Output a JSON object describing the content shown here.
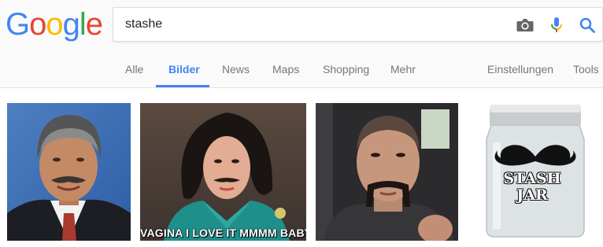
{
  "logo": {
    "letters": [
      "G",
      "o",
      "o",
      "g",
      "l",
      "e"
    ],
    "colors": [
      "#4285f4",
      "#ea4335",
      "#fbbc05",
      "#4285f4",
      "#34a853",
      "#ea4335"
    ]
  },
  "search": {
    "query": "stashe"
  },
  "icons": {
    "camera": "camera-icon",
    "microphone": "microphone-icon",
    "search": "search-icon"
  },
  "tabs": {
    "items": [
      {
        "label": "Alle"
      },
      {
        "label": "Bilder",
        "active": true
      },
      {
        "label": "News"
      },
      {
        "label": "Maps"
      },
      {
        "label": "Shopping"
      },
      {
        "label": "Mehr"
      }
    ],
    "settings": "Einstellungen",
    "tools": "Tools"
  },
  "results": {
    "meme_caption": "VAGINA I LOVE IT MMMM BABY",
    "jar_label_line1": "STASH",
    "jar_label_line2": "JAR"
  },
  "colors": {
    "accent": "#4285f4",
    "tab_text": "#777777"
  }
}
